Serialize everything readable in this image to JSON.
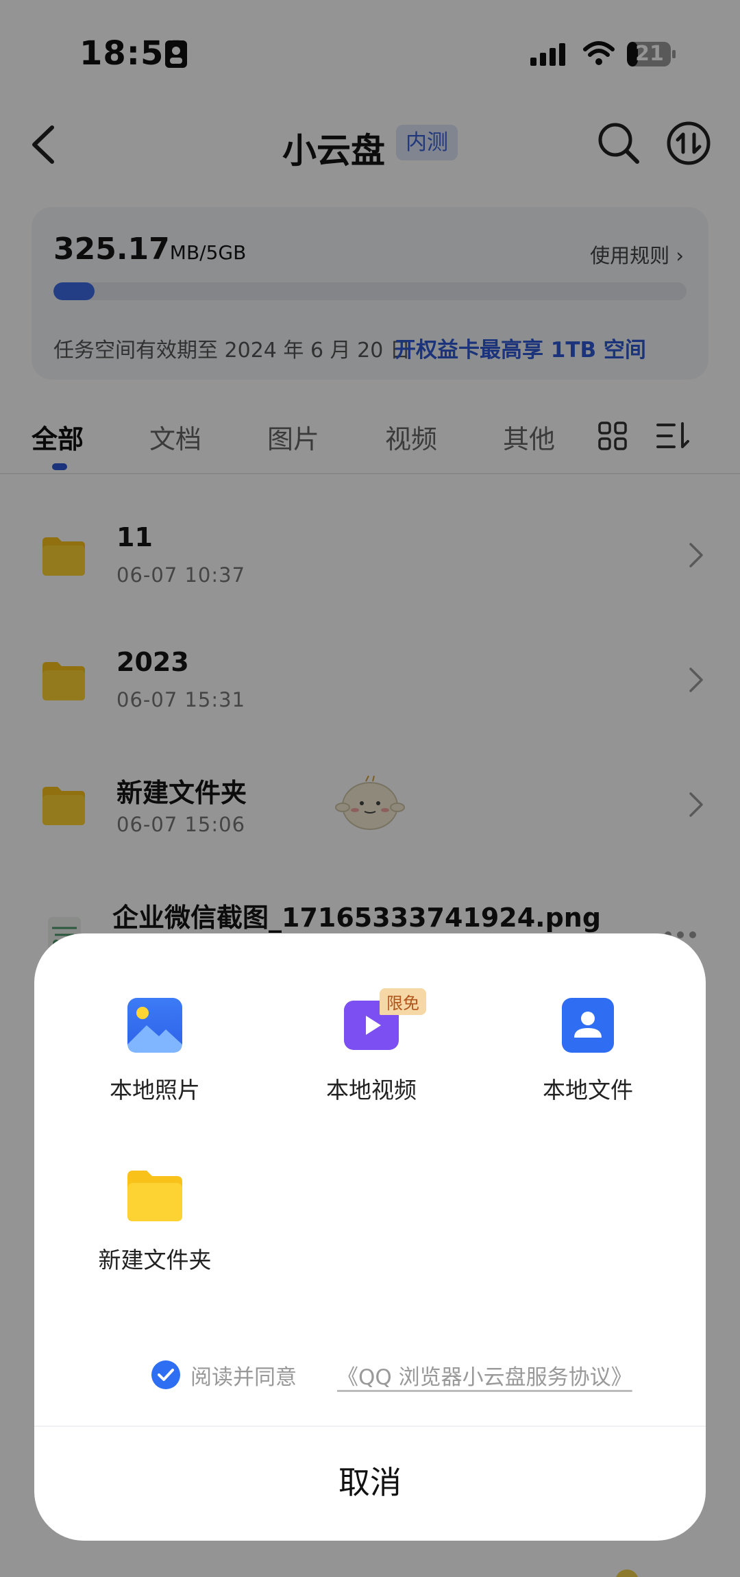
{
  "status_bar": {
    "time": "18:51",
    "battery": "21"
  },
  "nav": {
    "title": "小云盘",
    "badge": "内测"
  },
  "storage": {
    "used_value": "325.17",
    "used_unit": "MB/5GB",
    "usage_percent": 6.5,
    "rules_label": "使用规则 ›",
    "expire_text": "任务空间有效期至 2024 年 6 月 20 日",
    "promo_text": "开权益卡最高享 1TB 空间"
  },
  "tabs": [
    {
      "label": "全部",
      "active": true
    },
    {
      "label": "文档"
    },
    {
      "label": "图片"
    },
    {
      "label": "视频"
    },
    {
      "label": "其他"
    }
  ],
  "files": [
    {
      "name": "11",
      "date": "06-07   10:37"
    },
    {
      "name": "2023",
      "date": "06-07   15:31"
    },
    {
      "name": "新建文件夹",
      "date": "06-07   15:06"
    },
    {
      "name": "企业微信截图_17165333741924.png"
    }
  ],
  "sheet": {
    "actions": [
      {
        "label": "本地照片",
        "icon": "photo-icon"
      },
      {
        "label": "本地视频",
        "icon": "video-icon",
        "badge": "限免"
      },
      {
        "label": "本地文件",
        "icon": "contact-file-icon"
      },
      {
        "label": "新建文件夹",
        "icon": "folder-icon"
      }
    ],
    "agreement_prefix": "阅读并同意",
    "agreement_link": "《QQ 浏览器小云盘服务协议》",
    "cancel": "取消"
  },
  "colors": {
    "accent": "#2e58d2",
    "folder": "#f8c21a",
    "video": "#7b4ff2",
    "file": "#2f6ef3"
  }
}
